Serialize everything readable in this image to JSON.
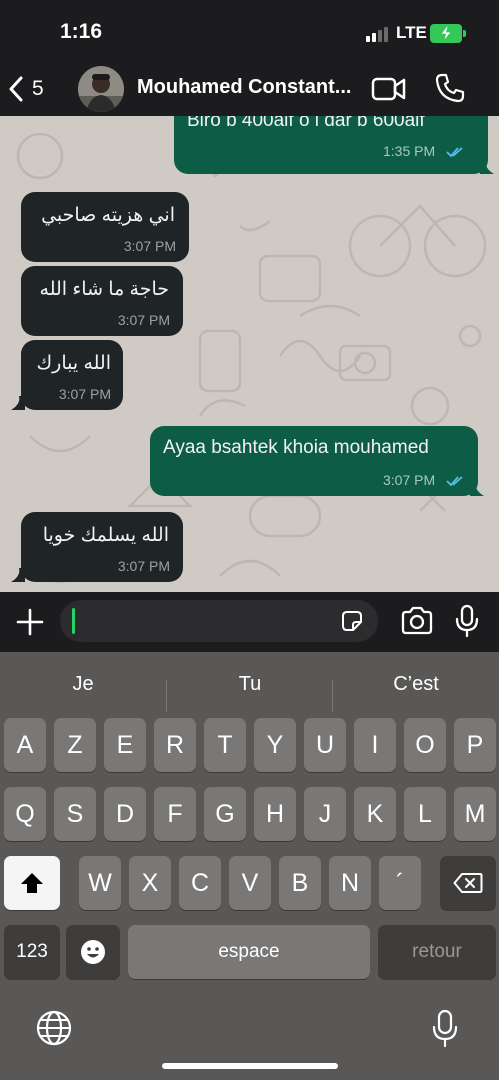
{
  "status_bar": {
    "time": "1:16",
    "network": "LTE",
    "battery_color": "#34c759"
  },
  "header": {
    "back_count": "5",
    "contact_name": "Mouhamed Constant...",
    "icons": [
      "chevron-left-icon",
      "video-camera-icon",
      "phone-icon"
    ]
  },
  "messages": [
    {
      "direction": "out",
      "text": "Biro b 400alf o l dar b 600alf",
      "time": "1:35 PM",
      "read": true
    },
    {
      "direction": "in",
      "text": "اني هزيته صاحبي",
      "time": "3:07 PM"
    },
    {
      "direction": "in",
      "text": "حاجة ما شاء الله",
      "time": "3:07 PM"
    },
    {
      "direction": "in",
      "text": "الله يبارك",
      "time": "3:07 PM"
    },
    {
      "direction": "out",
      "text": "Ayaa bsahtek khoia mouhamed",
      "time": "3:07 PM",
      "read": true
    },
    {
      "direction": "in",
      "text": "الله يسلمك خويا",
      "time": "3:07 PM"
    }
  ],
  "colors": {
    "incoming_bubble": "#1f2426",
    "outgoing_bubble": "#0d5c45",
    "read_ticks": "#53bdeb",
    "chat_wallpaper": "#cfcbc4"
  },
  "input": {
    "value": "",
    "icons": [
      "plus-icon",
      "sticker-icon",
      "camera-icon",
      "microphone-icon"
    ]
  },
  "keyboard": {
    "suggestions": [
      "Je",
      "Tu",
      "C’est"
    ],
    "row1": [
      "A",
      "Z",
      "E",
      "R",
      "T",
      "Y",
      "U",
      "I",
      "O",
      "P"
    ],
    "row2": [
      "Q",
      "S",
      "D",
      "F",
      "G",
      "H",
      "J",
      "K",
      "L",
      "M"
    ],
    "row3": [
      "W",
      "X",
      "C",
      "V",
      "B",
      "N",
      "´"
    ],
    "numbers_label": "123",
    "space_label": "espace",
    "return_label": "retour",
    "icons": [
      "shift-icon",
      "backspace-icon",
      "emoji-icon",
      "globe-icon",
      "dictation-icon"
    ]
  }
}
